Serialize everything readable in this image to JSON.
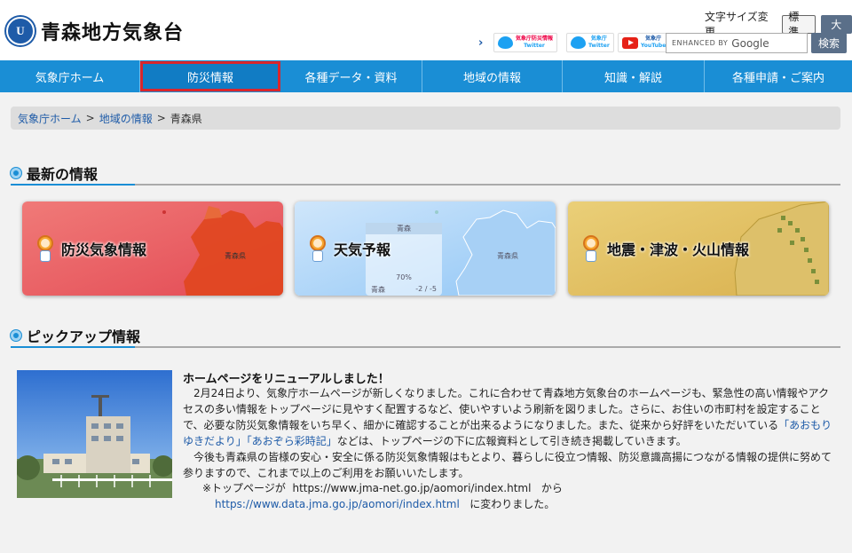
{
  "header": {
    "logo_mark": "U",
    "site_title": "青森地方気象台",
    "text_size_label": "文字サイズ変更",
    "text_size_standard": "標準",
    "text_size_large": "大",
    "sns": [
      {
        "icon": "twitter-icon",
        "line1": "気象庁防災情報",
        "line2": "Twitter"
      },
      {
        "icon": "twitter-icon",
        "line1": "気象庁",
        "line2": "Twitter"
      },
      {
        "icon": "youtube-icon",
        "line1": "気象庁",
        "line2": "YouTube"
      }
    ],
    "search_prefix": "ENHANCED BY",
    "search_brand": "Google",
    "search_button": "検索"
  },
  "nav": {
    "items": [
      {
        "label": "気象庁ホーム"
      },
      {
        "label": "防災情報"
      },
      {
        "label": "各種データ・資料"
      },
      {
        "label": "地域の情報"
      },
      {
        "label": "知識・解説"
      },
      {
        "label": "各種申請・ご案内"
      }
    ]
  },
  "breadcrumb": {
    "items": [
      "気象庁ホーム",
      "地域の情報"
    ],
    "current": "青森県",
    "separator": ">"
  },
  "latest": {
    "heading": "最新の情報",
    "cards": [
      {
        "title": "防災気象情報",
        "map_label": "青森県"
      },
      {
        "title": "天気予報",
        "map_label": "青森県",
        "fc_place": "青森",
        "fc_pop": "70%",
        "fc_row_place": "青森",
        "fc_row_temp": "-2 / -5"
      },
      {
        "title": "地震・津波・火山情報"
      }
    ]
  },
  "pickup": {
    "heading": "ピックアップ情報",
    "title": "ホームページをリニューアルしました！",
    "para1_a": "2月24日より、気象庁ホームページが新しくなりました。これに合わせて青森地方気象台のホームページも、緊急性の高い情報やアクセスの多い情報をトップページに見やすく配置するなど、使いやすいよう刷新を図りました。さらに、お住いの市町村を設定することで、必要な防災気象情報をいち早く、細かに確認することが出来るようになりました。また、従来から好評をいただいている",
    "link1": "「あおもりゆきだより」",
    "link2": "「あおぞら彩時記」",
    "para1_b": "などは、トップページの下に広報資料として引き続き掲載していきます。",
    "para2": "今後も青森県の皆様の安心・安全に係る防災気象情報はもとより、暮らしに役立つ情報、防災意識高揚につながる情報の提供に努めて参りますので、これまで以上のご利用をお願いいたします。",
    "url_prefix": "※トップページが",
    "old_url": "https://www.jma-net.go.jp/aomori/index.html",
    "url_mid": "から",
    "new_url": "https://www.data.jma.go.jp/aomori/index.html",
    "url_suffix": "に変わりました。"
  }
}
